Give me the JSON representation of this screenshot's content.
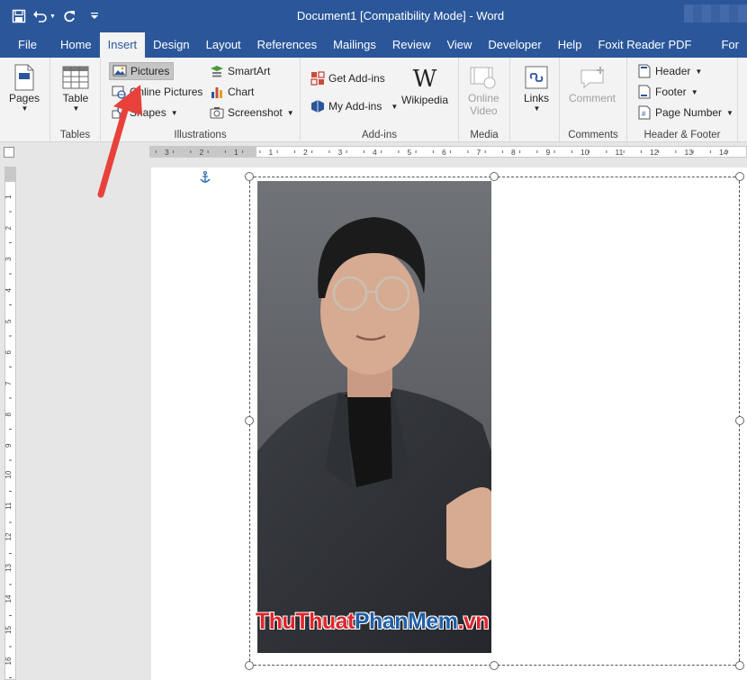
{
  "window": {
    "title": "Document1 [Compatibility Mode]  -  Word"
  },
  "tabs": [
    "File",
    "Home",
    "Insert",
    "Design",
    "Layout",
    "References",
    "Mailings",
    "Review",
    "View",
    "Developer",
    "Help",
    "Foxit Reader PDF",
    "For"
  ],
  "active_tab": "Insert",
  "ribbon": {
    "pages": {
      "label": "Pages"
    },
    "tables": {
      "table_label": "Table",
      "group": "Tables"
    },
    "illustrations": {
      "group": "Illustrations",
      "pictures": "Pictures",
      "online_pictures": "Online Pictures",
      "shapes": "Shapes",
      "smartart": "SmartArt",
      "chart": "Chart",
      "screenshot": "Screenshot"
    },
    "addins": {
      "group": "Add-ins",
      "get_addins": "Get Add-ins",
      "my_addins": "My Add-ins",
      "wikipedia": "Wikipedia",
      "wikipedia_glyph": "W"
    },
    "media": {
      "group": "Media",
      "online_video_1": "Online",
      "online_video_2": "Video"
    },
    "links": {
      "label": "Links"
    },
    "comments": {
      "group": "Comments",
      "comment": "Comment"
    },
    "header_footer": {
      "group": "Header & Footer",
      "header": "Header",
      "footer": "Footer",
      "page_number": "Page Number"
    }
  },
  "ruler": {
    "h_labels": [
      "3",
      "2",
      "1",
      "1",
      "2",
      "3",
      "4",
      "5",
      "6",
      "7",
      "8",
      "9",
      "10",
      "11",
      "12",
      "13",
      "14"
    ],
    "v_labels": [
      "1",
      "2",
      "3",
      "4",
      "5",
      "6",
      "7",
      "8",
      "9",
      "10",
      "11",
      "12",
      "13",
      "14",
      "15",
      "16"
    ]
  },
  "watermark": {
    "part_a": "ThuThuat",
    "part_b": "PhanMem",
    "part_c": ".vn"
  },
  "colors": {
    "title_bar": "#2b579a",
    "ribbon": "#f3f3f3",
    "arrow": "#e8413b"
  }
}
